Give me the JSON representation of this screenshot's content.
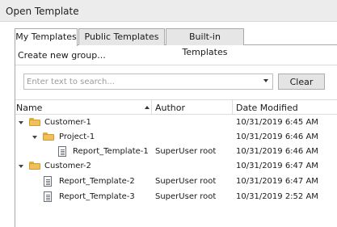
{
  "window": {
    "title": "Open Template"
  },
  "tabs": [
    {
      "label": "My Templates",
      "active": true
    },
    {
      "label": "Public Templates",
      "active": false
    },
    {
      "label": "Built-in Templates",
      "active": false
    }
  ],
  "create_group_label": "Create new group...",
  "search": {
    "placeholder": "Enter text to search...",
    "value": ""
  },
  "clear_label": "Clear",
  "columns": {
    "name": "Name",
    "author": "Author",
    "date": "Date Modified"
  },
  "rows": [
    {
      "type": "folder",
      "expanded": true,
      "name": "Customer-1",
      "author": "",
      "date": "10/31/2019 6:45 AM"
    },
    {
      "type": "folder",
      "expanded": true,
      "name": "Project-1",
      "author": "",
      "date": "10/31/2019 6:46 AM"
    },
    {
      "type": "template",
      "name": "Report_Template-1",
      "author": "SuperUser root",
      "date": "10/31/2019 6:46 AM"
    },
    {
      "type": "folder",
      "expanded": true,
      "name": "Customer-2",
      "author": "",
      "date": "10/31/2019 6:47 AM"
    },
    {
      "type": "template",
      "name": "Report_Template-2",
      "author": "SuperUser root",
      "date": "10/31/2019 6:47 AM"
    },
    {
      "type": "template",
      "name": "Report_Template-3",
      "author": "SuperUser root",
      "date": "10/31/2019 2:52 AM"
    }
  ]
}
